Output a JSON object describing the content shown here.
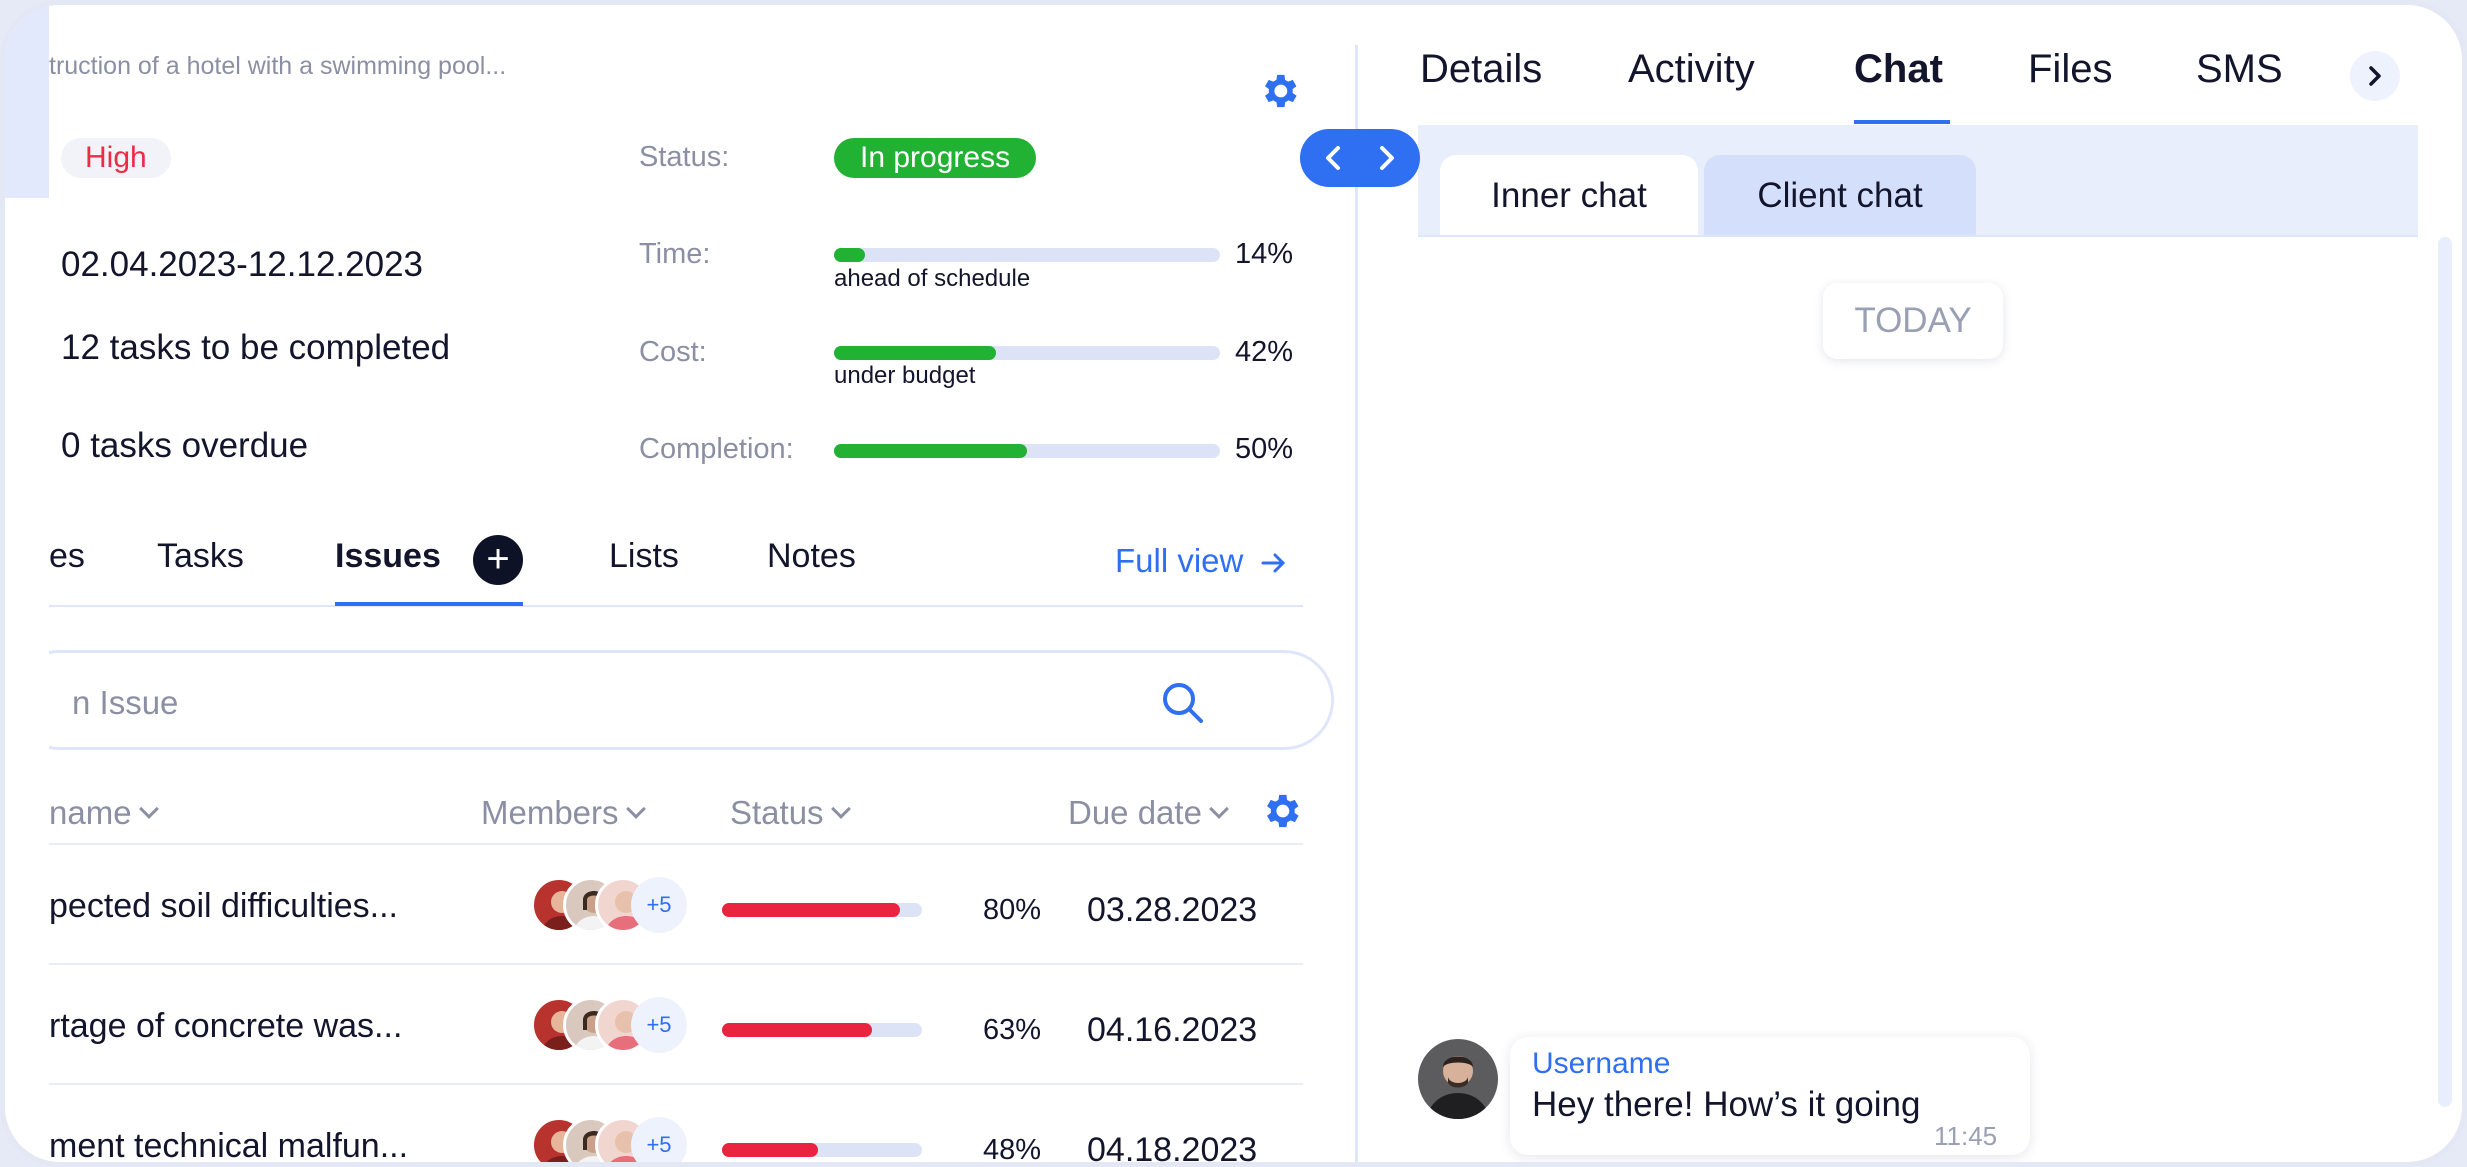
{
  "project": {
    "title": "truction of a hotel with a swimming pool...",
    "priority": "High",
    "dates": "02.04.2023-12.12.2023",
    "tasks_remaining": "12 tasks to be completed",
    "tasks_overdue": "0 tasks overdue"
  },
  "stats": {
    "status_label": "Status:",
    "status_value": "In progress",
    "time_label": "Time:",
    "time_note": "ahead of schedule",
    "time_pct": "14%",
    "time_fill": 0.08,
    "cost_label": "Cost:",
    "cost_note": "under budget",
    "cost_pct": "42%",
    "cost_fill": 0.42,
    "completion_label": "Completion:",
    "completion_pct": "50%",
    "completion_fill": 0.5
  },
  "tabs": {
    "partial": "es",
    "tasks": "Tasks",
    "issues": "Issues",
    "lists": "Lists",
    "notes": "Notes",
    "full_view": "Full view"
  },
  "search": {
    "placeholder": "n Issue"
  },
  "table": {
    "headers": {
      "name": "name",
      "members": "Members",
      "status": "Status",
      "due_date": "Due date"
    },
    "rows": [
      {
        "name": "pected soil difficulties...",
        "more": "+5",
        "pct": "80%",
        "fill": 0.89,
        "date": "03.28.2023"
      },
      {
        "name": "rtage of concrete was...",
        "more": "+5",
        "pct": "63%",
        "fill": 0.75,
        "date": "04.16.2023"
      },
      {
        "name": "ment technical malfun...",
        "more": "+5",
        "pct": "48%",
        "fill": 0.48,
        "date": "04.18.2023"
      }
    ]
  },
  "right": {
    "tabs": [
      "Details",
      "Activity",
      "Chat",
      "Files",
      "SMS"
    ],
    "subtabs": {
      "inner": "Inner chat",
      "client": "Client chat"
    },
    "today": "TODAY",
    "message": {
      "user": "Username",
      "text": "Hey there! How’s it going",
      "time": "11:45"
    }
  },
  "colors": {
    "accent": "#2f6ff2",
    "success": "#21b233",
    "danger": "#ea2340",
    "priority": "#ee2b47"
  }
}
